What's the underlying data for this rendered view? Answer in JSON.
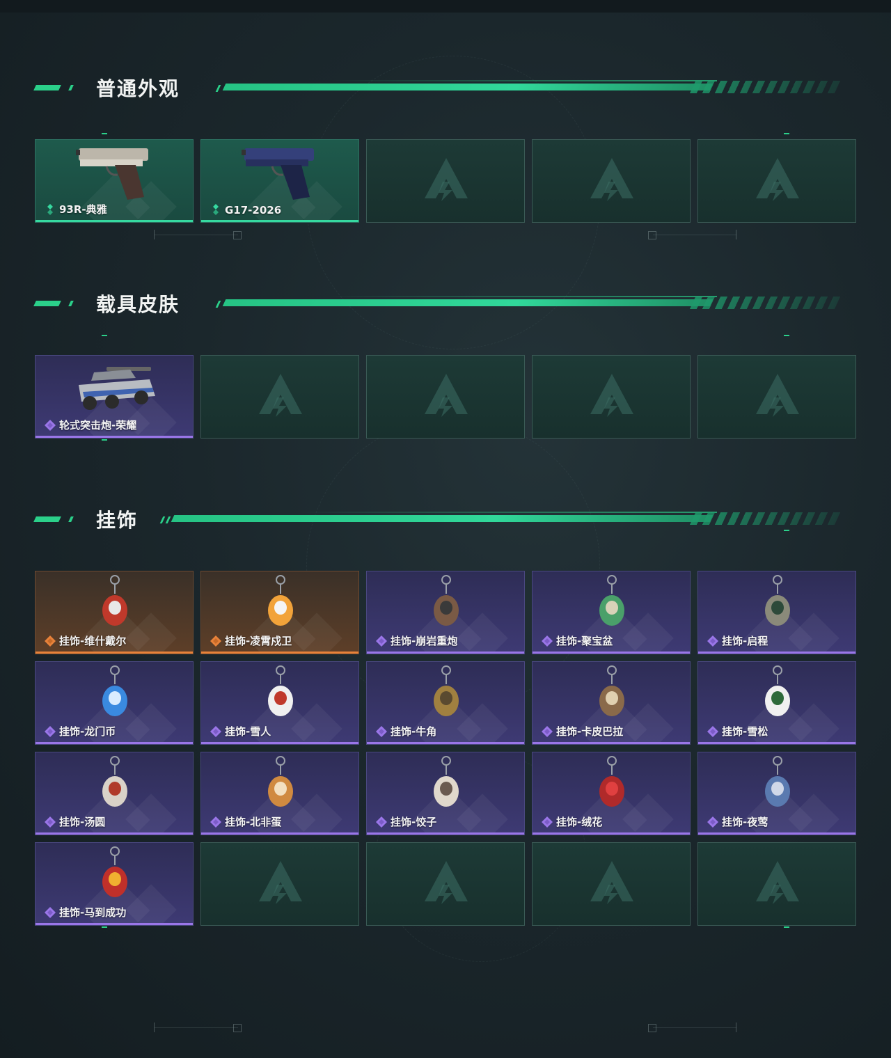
{
  "sections": [
    {
      "title": "普通外观",
      "items": [
        {
          "label": "93R-典雅",
          "rarity": "green",
          "icon": "pistol-icon"
        },
        {
          "label": "G17-2026",
          "rarity": "green",
          "icon": "pistol-icon"
        },
        {
          "empty": true
        },
        {
          "empty": true
        },
        {
          "empty": true
        }
      ]
    },
    {
      "title": "载具皮肤",
      "items": [
        {
          "label": "轮式突击炮-荣耀",
          "rarity": "purple",
          "icon": "armored-vehicle-icon"
        },
        {
          "empty": true
        },
        {
          "empty": true
        },
        {
          "empty": true
        },
        {
          "empty": true
        }
      ]
    },
    {
      "title": "挂饰",
      "items": [
        {
          "label": "挂饰-维什戴尔",
          "rarity": "orange",
          "icon": "charm-icon"
        },
        {
          "label": "挂饰-凌霄戍卫",
          "rarity": "orange",
          "icon": "charm-icon"
        },
        {
          "label": "挂饰-崩岩重炮",
          "rarity": "purple",
          "icon": "charm-icon"
        },
        {
          "label": "挂饰-聚宝盆",
          "rarity": "purple",
          "icon": "charm-icon"
        },
        {
          "label": "挂饰-启程",
          "rarity": "purple",
          "icon": "charm-icon"
        },
        {
          "label": "挂饰-龙门币",
          "rarity": "purple",
          "icon": "charm-icon"
        },
        {
          "label": "挂饰-雪人",
          "rarity": "purple",
          "icon": "charm-icon"
        },
        {
          "label": "挂饰-牛角",
          "rarity": "purple",
          "icon": "charm-icon"
        },
        {
          "label": "挂饰-卡皮巴拉",
          "rarity": "purple",
          "icon": "charm-icon"
        },
        {
          "label": "挂饰-雪松",
          "rarity": "purple",
          "icon": "charm-icon"
        },
        {
          "label": "挂饰-汤圆",
          "rarity": "purple",
          "icon": "charm-icon"
        },
        {
          "label": "挂饰-北非蛋",
          "rarity": "purple",
          "icon": "charm-icon"
        },
        {
          "label": "挂饰-饺子",
          "rarity": "purple",
          "icon": "charm-icon"
        },
        {
          "label": "挂饰-绒花",
          "rarity": "purple",
          "icon": "charm-icon"
        },
        {
          "label": "挂饰-夜莺",
          "rarity": "purple",
          "icon": "charm-icon"
        },
        {
          "label": "挂饰-马到成功",
          "rarity": "purple",
          "icon": "charm-icon"
        },
        {
          "empty": true
        },
        {
          "empty": true
        },
        {
          "empty": true
        },
        {
          "empty": true
        }
      ]
    }
  ],
  "colors": {
    "accent": "#2bd08a",
    "rarity_green": "#36d9a0",
    "rarity_purple": "#9a76e8",
    "rarity_orange": "#e8823a",
    "empty_card": "#1d3a36"
  }
}
